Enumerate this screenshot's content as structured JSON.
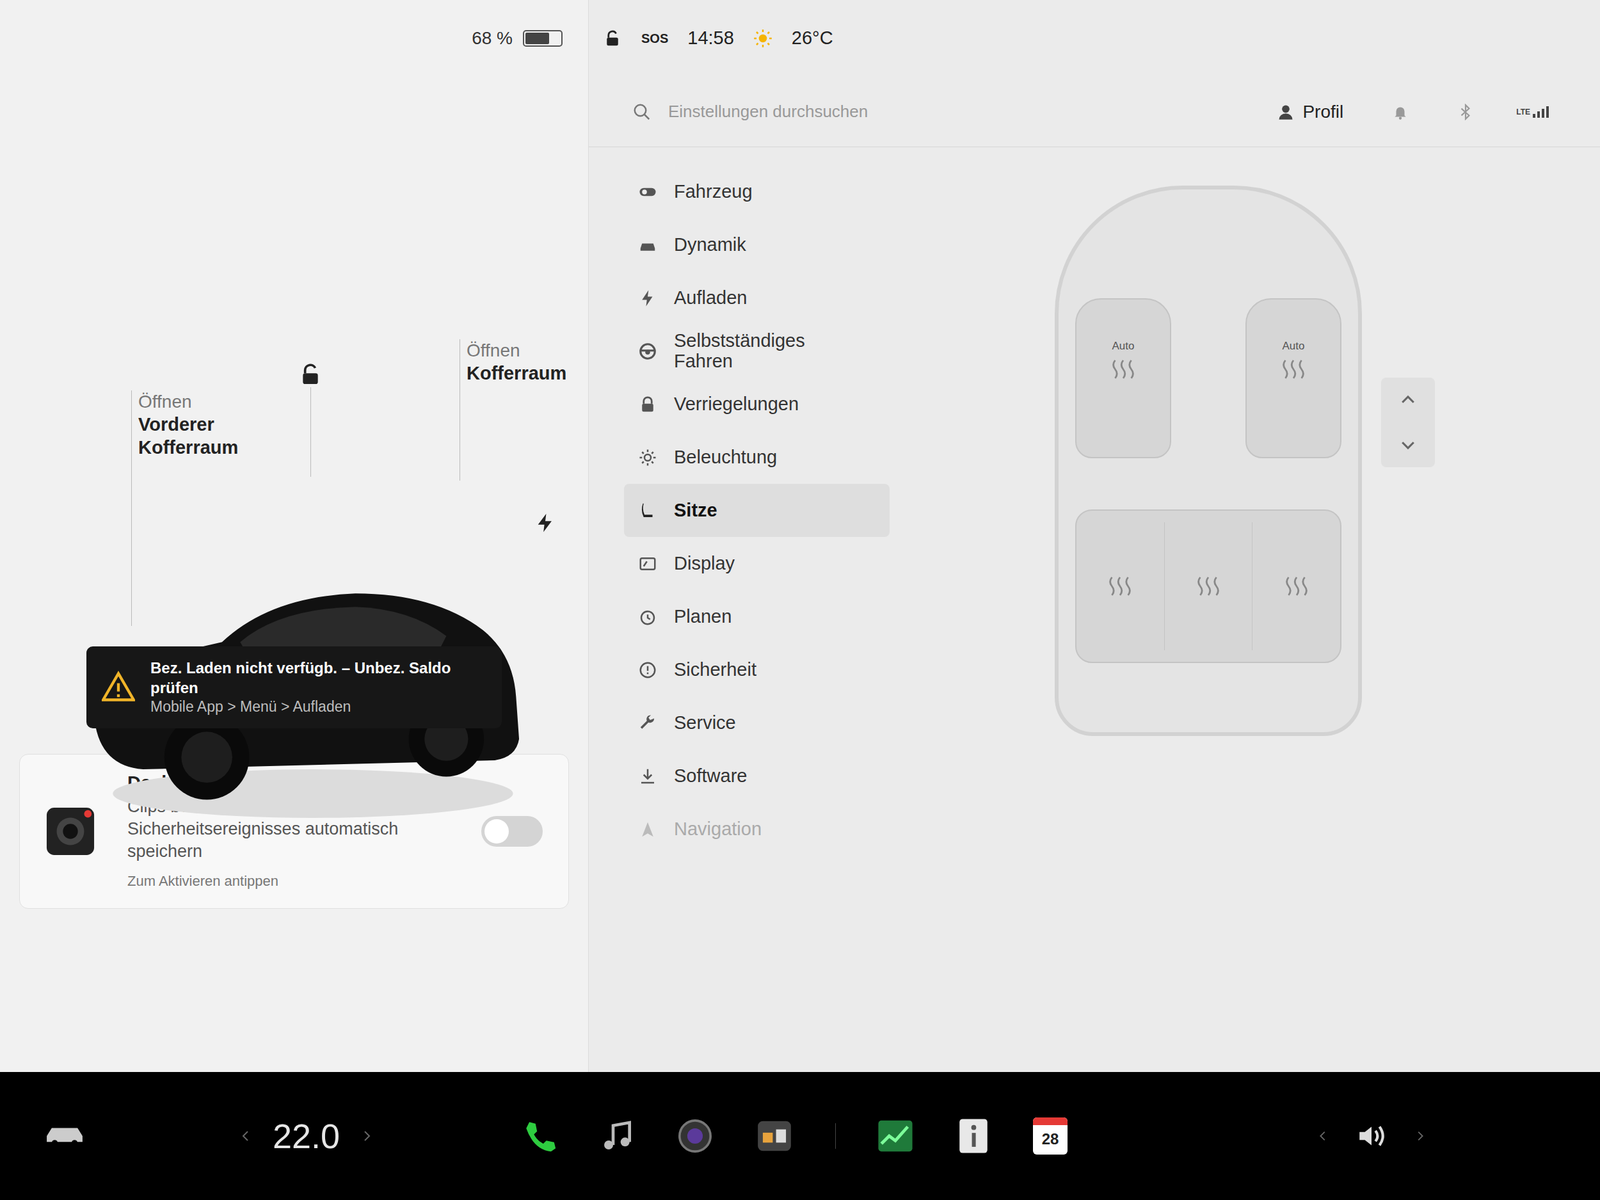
{
  "status": {
    "battery": "68 %",
    "battery_level": 0.68,
    "sos": "SOS",
    "time": "14:58",
    "temperature": "26°C"
  },
  "car": {
    "locked": false,
    "front_trunk": {
      "action": "Öffnen",
      "label": "Vorderer Kofferraum"
    },
    "rear_trunk": {
      "action": "Öffnen",
      "label": "Kofferraum"
    }
  },
  "alert": {
    "title": "Bez. Laden nicht verfügb. – Unbez. Saldo prüfen",
    "path": "Mobile App > Menü > Aufladen"
  },
  "dashcam": {
    "title": "Dashcam aktivieren",
    "description": "Clips bei Erkennung eines Sicherheitsereignisses automatisch speichern",
    "hint": "Zum Aktivieren antippen",
    "on": false
  },
  "search": {
    "placeholder": "Einstellungen durchsuchen"
  },
  "profile": "Profil",
  "network": "LTE",
  "menu": [
    {
      "label": "Fahrzeug",
      "selected": false
    },
    {
      "label": "Dynamik",
      "selected": false
    },
    {
      "label": "Aufladen",
      "selected": false
    },
    {
      "label": "Selbstständiges Fahren",
      "selected": false
    },
    {
      "label": "Verriegelungen",
      "selected": false
    },
    {
      "label": "Beleuchtung",
      "selected": false
    },
    {
      "label": "Sitze",
      "selected": true
    },
    {
      "label": "Display",
      "selected": false
    },
    {
      "label": "Planen",
      "selected": false
    },
    {
      "label": "Sicherheit",
      "selected": false
    },
    {
      "label": "Service",
      "selected": false
    },
    {
      "label": "Software",
      "selected": false
    },
    {
      "label": "Navigation",
      "selected": false
    }
  ],
  "seats": {
    "front": [
      {
        "label": "Auto",
        "heat_on": false
      },
      {
        "label": "Auto",
        "heat_on": false
      }
    ],
    "rear": [
      {
        "heat_on": false
      },
      {
        "heat_on": false
      },
      {
        "heat_on": false
      }
    ]
  },
  "climate": {
    "temperature": "22.0"
  },
  "dock": {
    "calendar_day": "28"
  }
}
